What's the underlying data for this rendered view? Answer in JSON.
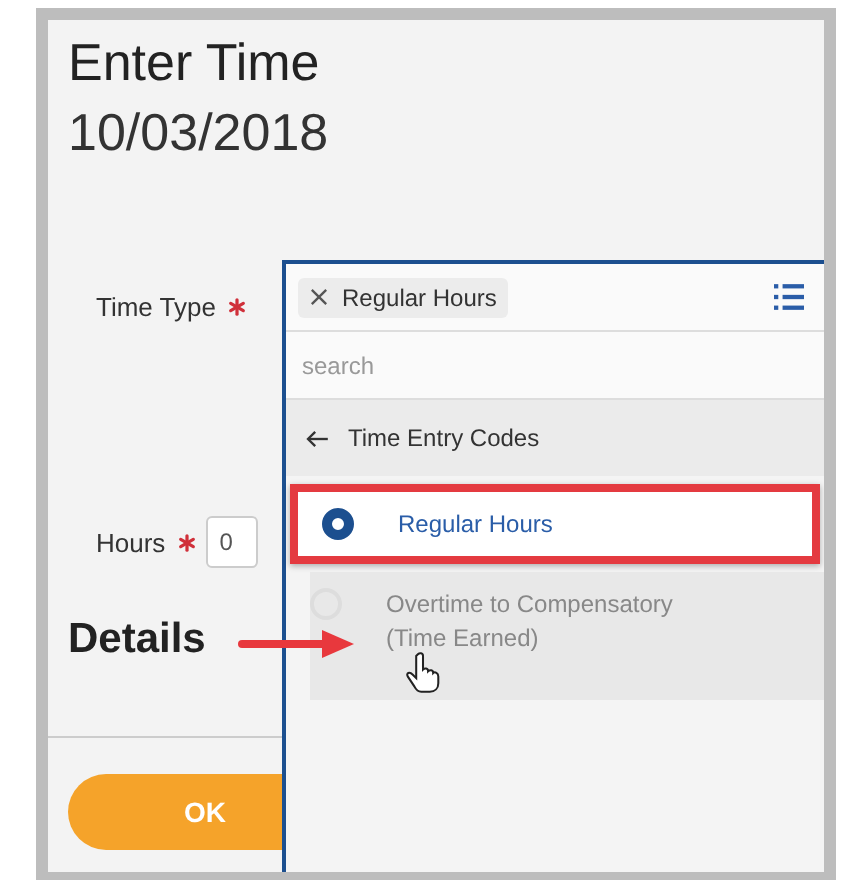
{
  "page": {
    "title": "Enter Time",
    "date": "10/03/2018"
  },
  "fields": [
    {
      "kind": "select",
      "label": "Time Type",
      "required": true
    },
    {
      "kind": "number",
      "label": "Hours",
      "required": true,
      "value": "0"
    }
  ],
  "section": {
    "title": "Details"
  },
  "buttons": [
    {
      "label": "OK"
    }
  ],
  "dropdown": {
    "chip": "Regular Hours",
    "placeholder": "search",
    "back": "Time Entry Codes",
    "options": [
      {
        "label": "Regular Hours",
        "selected": true,
        "highlighted": true
      },
      {
        "label": "Overtime to Compensatory (Time Earned)",
        "selected": false,
        "highlighted": false
      }
    ]
  }
}
